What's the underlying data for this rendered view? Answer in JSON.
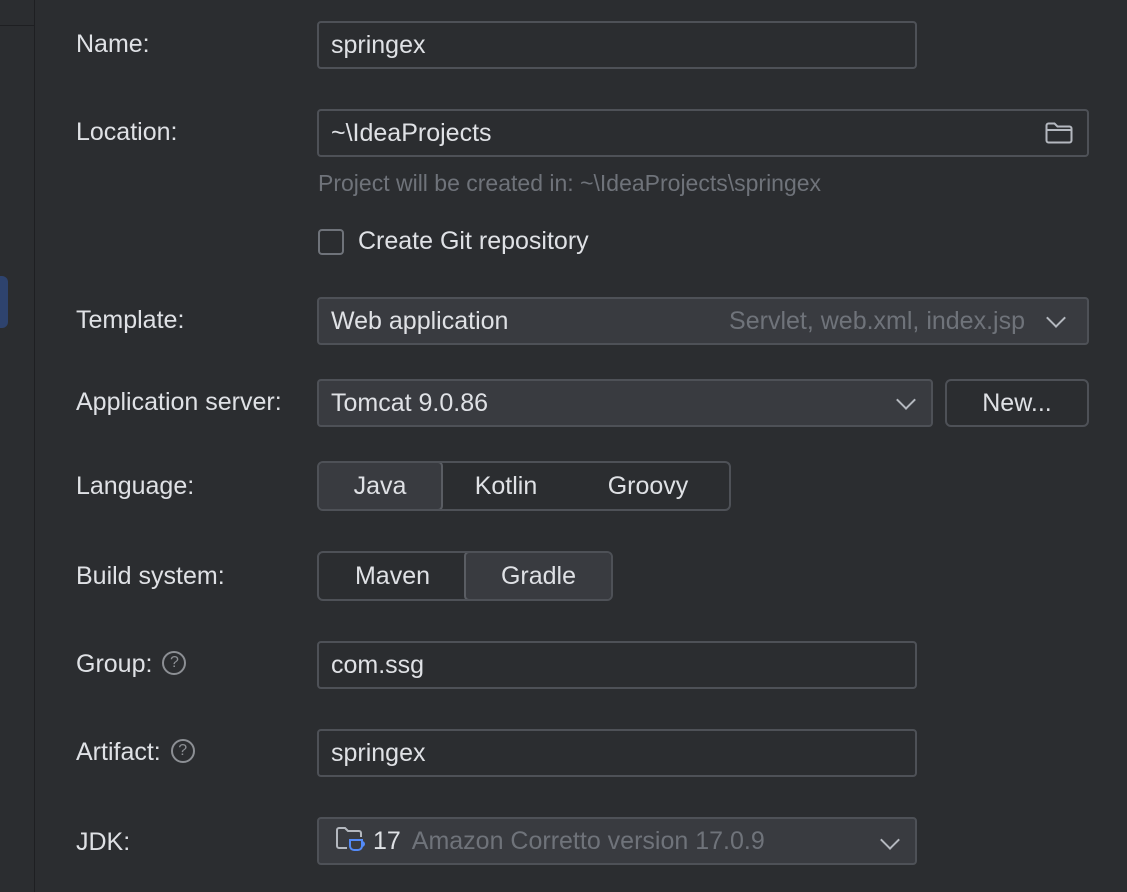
{
  "form": {
    "name": {
      "label": "Name:",
      "value": "springex"
    },
    "location": {
      "label": "Location:",
      "value": "~\\IdeaProjects",
      "hint": "Project will be created in: ~\\IdeaProjects\\springex"
    },
    "git": {
      "label": "Create Git repository",
      "checked": false
    },
    "template": {
      "label": "Template:",
      "value": "Web application",
      "detail": "Servlet, web.xml, index.jsp"
    },
    "app_server": {
      "label": "Application server:",
      "value": "Tomcat 9.0.86",
      "new_button": "New..."
    },
    "language": {
      "label": "Language:",
      "options": [
        "Java",
        "Kotlin",
        "Groovy"
      ],
      "selected": "Java"
    },
    "build_system": {
      "label": "Build system:",
      "options": [
        "Maven",
        "Gradle"
      ],
      "selected": "Gradle"
    },
    "group": {
      "label": "Group:",
      "value": "com.ssg",
      "help": "?"
    },
    "artifact": {
      "label": "Artifact:",
      "value": "springex",
      "help": "?"
    },
    "jdk": {
      "label": "JDK:",
      "version": "17",
      "detail": "Amazon Corretto version 17.0.9"
    }
  },
  "colors": {
    "background": "#2b2d30",
    "border": "#4e5157",
    "text": "#dfe1e5",
    "secondary_text": "#6f737a",
    "selection_accent": "#2e436e"
  },
  "icons": [
    "folder-icon",
    "chevron-down-icon",
    "help-icon",
    "jdk-folder-icon"
  ]
}
